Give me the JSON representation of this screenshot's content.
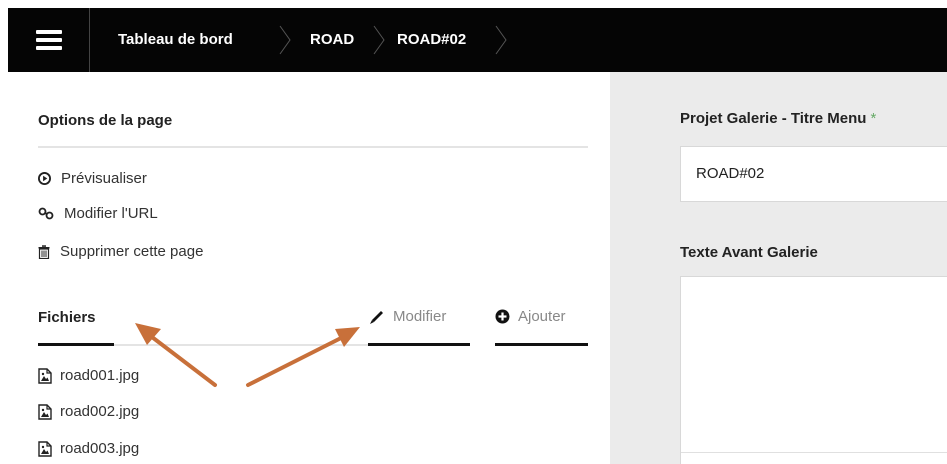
{
  "header": {
    "menu_icon": "hamburger-icon",
    "breadcrumbs": [
      "Tableau de bord",
      "ROAD",
      "ROAD#02"
    ]
  },
  "page_options": {
    "title": "Options de la page",
    "actions": [
      {
        "label": "Prévisualiser",
        "icon": "play-circle-icon"
      },
      {
        "label": "Modifier l'URL",
        "icon": "link-icon"
      },
      {
        "label": "Supprimer cette page",
        "icon": "trash-icon"
      }
    ]
  },
  "files": {
    "title": "Fichiers",
    "edit_label": "Modifier",
    "add_label": "Ajouter",
    "items": [
      "road001.jpg",
      "road002.jpg",
      "road003.jpg"
    ]
  },
  "form": {
    "menu_title_label": "Projet Galerie - Titre Menu",
    "required_mark": "*",
    "menu_title_value": "ROAD#02",
    "text_before_label": "Texte Avant Galerie"
  },
  "colors": {
    "topbar": "#050505",
    "right_panel": "#ebebeb",
    "arrow": "#c8703a",
    "required": "#66aa66"
  }
}
